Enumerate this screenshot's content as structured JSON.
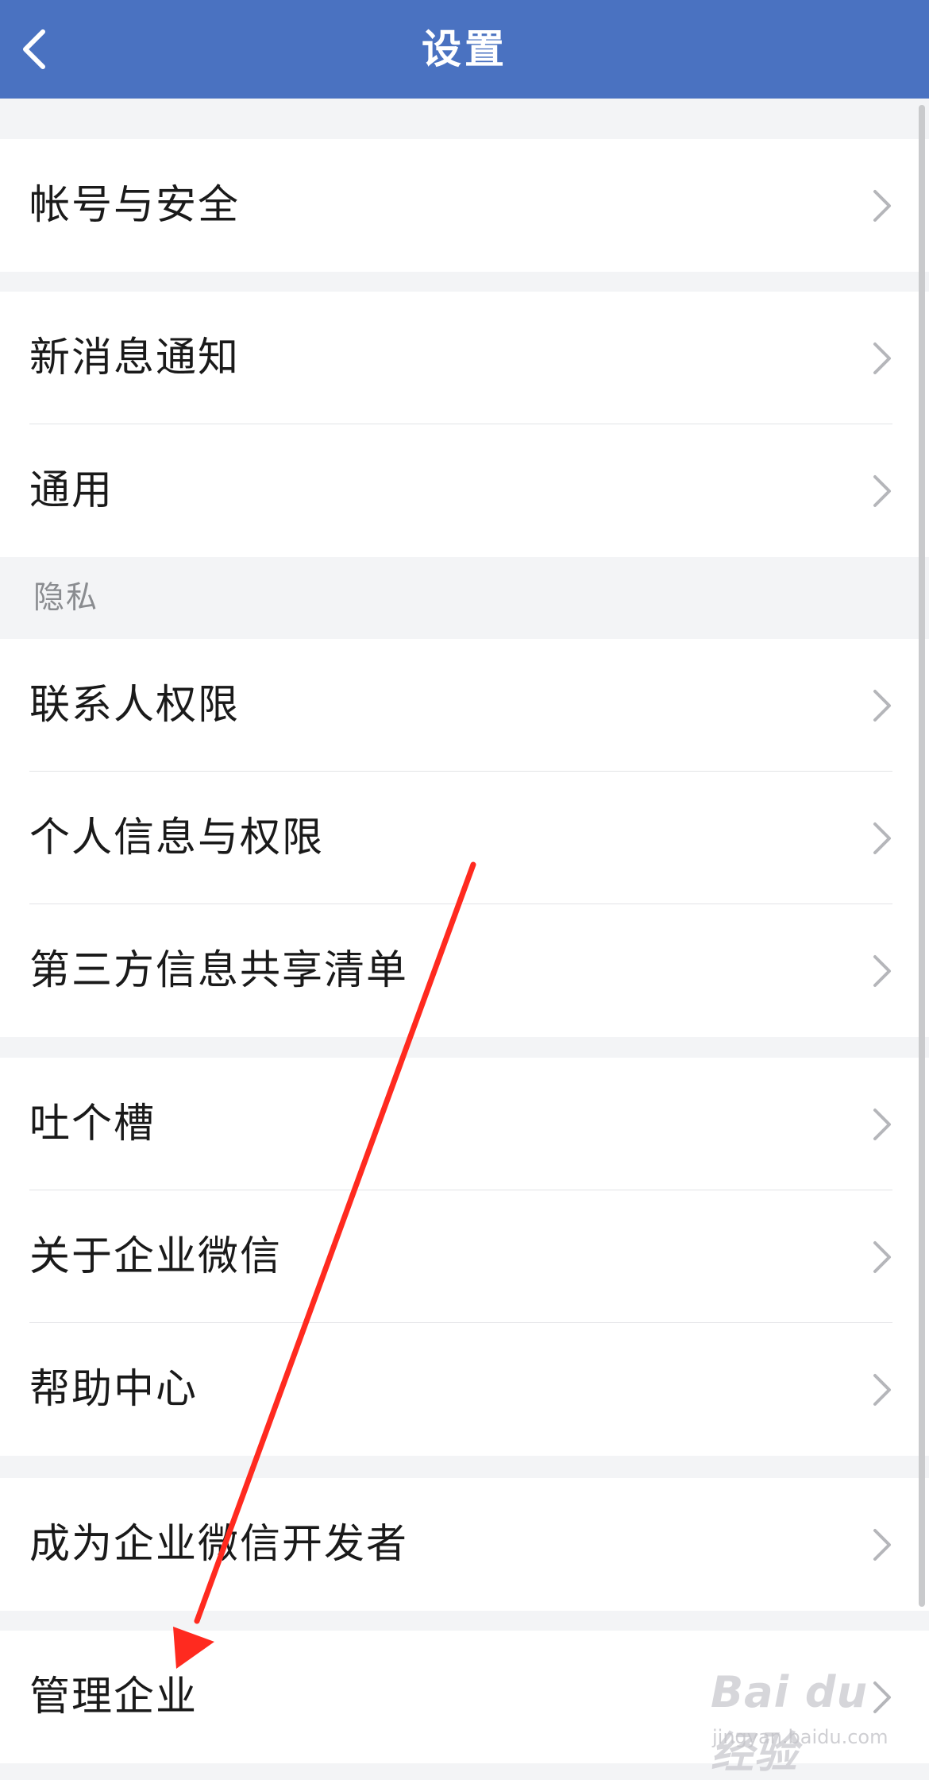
{
  "header": {
    "title": "设置",
    "back_icon": "chevron-left-icon"
  },
  "groups": [
    {
      "items": [
        {
          "label": "帐号与安全"
        }
      ]
    },
    {
      "items": [
        {
          "label": "新消息通知"
        },
        {
          "label": "通用"
        }
      ]
    },
    {
      "section_header": "隐私",
      "items": [
        {
          "label": "联系人权限"
        },
        {
          "label": "个人信息与权限"
        },
        {
          "label": "第三方信息共享清单"
        }
      ]
    },
    {
      "items": [
        {
          "label": "吐个槽"
        },
        {
          "label": "关于企业微信"
        },
        {
          "label": "帮助中心"
        }
      ]
    },
    {
      "items": [
        {
          "label": "成为企业微信开发者"
        }
      ]
    },
    {
      "items": [
        {
          "label": "管理企业"
        }
      ]
    }
  ],
  "annotation": {
    "type": "red-arrow",
    "color": "#ff2a1f",
    "points_to": "管理企业"
  },
  "watermark": {
    "logo_text": "Bai du 经验",
    "url": "jingyan.baidu.com"
  },
  "colors": {
    "navbar": "#4a72c1",
    "background": "#f3f4f6",
    "chevron": "#b5b6ba"
  }
}
